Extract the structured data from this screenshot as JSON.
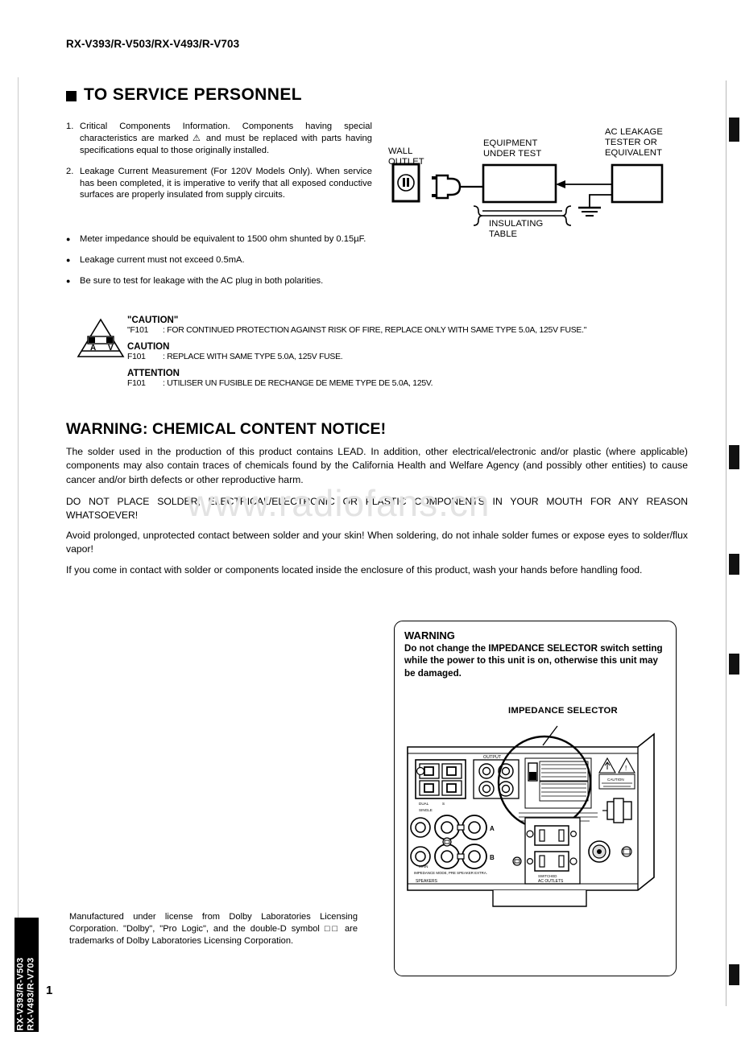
{
  "header": {
    "models": "RX-V393/R-V503/RX-V493/R-V703"
  },
  "section": {
    "title": "TO SERVICE PERSONNEL"
  },
  "notes": [
    {
      "num": "1.",
      "text": "Critical Components Information. Components having special characteristics are marked ⚠ and must be replaced with parts having specifications equal to those originally installed."
    },
    {
      "num": "2.",
      "text": "Leakage Current Measurement (For 120V Models Only). When service has been completed, it is imperative to verify that all exposed conductive surfaces are properly insulated from supply circuits."
    }
  ],
  "bullets": [
    "Meter impedance should be equivalent to 1500 ohm shunted by 0.15µF.",
    "Leakage current must not exceed 0.5mA.",
    "Be sure to test for leakage with the AC plug in both polarities."
  ],
  "diagram": {
    "wall_outlet": "WALL\nOUTLET",
    "equipment": "EQUIPMENT\nUNDER TEST",
    "tester": "AC LEAKAGE\nTESTER OR\nEQUIVALENT",
    "insulating_table": "INSULATING\nTABLE"
  },
  "caution_block": {
    "symbol_letters": {
      "left": "A",
      "right": "V"
    },
    "entries": [
      {
        "heading": "\"CAUTION\"",
        "code": "\"F101",
        "text": ": FOR CONTINUED PROTECTION AGAINST RISK OF FIRE, REPLACE ONLY WITH SAME TYPE 5.0A, 125V FUSE.\""
      },
      {
        "heading": "CAUTION",
        "code": "F101",
        "text": ": REPLACE WITH SAME TYPE 5.0A, 125V FUSE."
      },
      {
        "heading": "ATTENTION",
        "code": "F101",
        "text": ": UTILISER UN FUSIBLE DE RECHANGE DE MEME TYPE DE 5.0A, 125V."
      }
    ]
  },
  "chemical_warning": {
    "title": "WARNING: CHEMICAL CONTENT NOTICE!",
    "p1": "The solder used in the production of this product contains LEAD. In addition, other electrical/electronic and/or plastic (where applicable) components may also contain traces of chemicals found by the California Health and Welfare Agency (and possibly other entities) to cause cancer and/or birth defects or other reproductive harm.",
    "p2": "DO NOT PLACE SOLDER, ELECTRICAL/ELECTRONIC OR PLASTIC COMPONENTS IN YOUR MOUTH FOR ANY REASON WHATSOEVER!",
    "p3": "Avoid prolonged, unprotected contact between solder and your skin! When soldering, do not inhale solder fumes or expose eyes to solder/flux vapor!",
    "p4": "If you come in contact with solder or components located inside the enclosure of this product, wash your hands before handling food."
  },
  "impedance_warning": {
    "title": "WARNING",
    "text": "Do not change the IMPEDANCE SELECTOR switch setting while the power to this unit is on, otherwise this unit may be damaged.",
    "callout": "IMPEDANCE SELECTOR",
    "rear_panel": {
      "output_label": "OUTPUT",
      "speaker_a": "A",
      "speaker_b": "B",
      "speakers_label": "SPEAKERS",
      "ac_outlets_label": "AC OUTLETS",
      "caution_label": "CAUTION"
    }
  },
  "dolby": {
    "text": "Manufactured under license from Dolby Laboratories Licensing Corporation. \"Dolby\", \"Pro Logic\", and the double-D symbol □□ are trademarks of Dolby Laboratories Licensing Corporation."
  },
  "footer": {
    "side_tab_line1": "RX-V393/R-V503",
    "side_tab_line2": "RX-V493/R-V703",
    "page_number": "1"
  },
  "watermark": {
    "text": "www.radiofans.cn"
  }
}
